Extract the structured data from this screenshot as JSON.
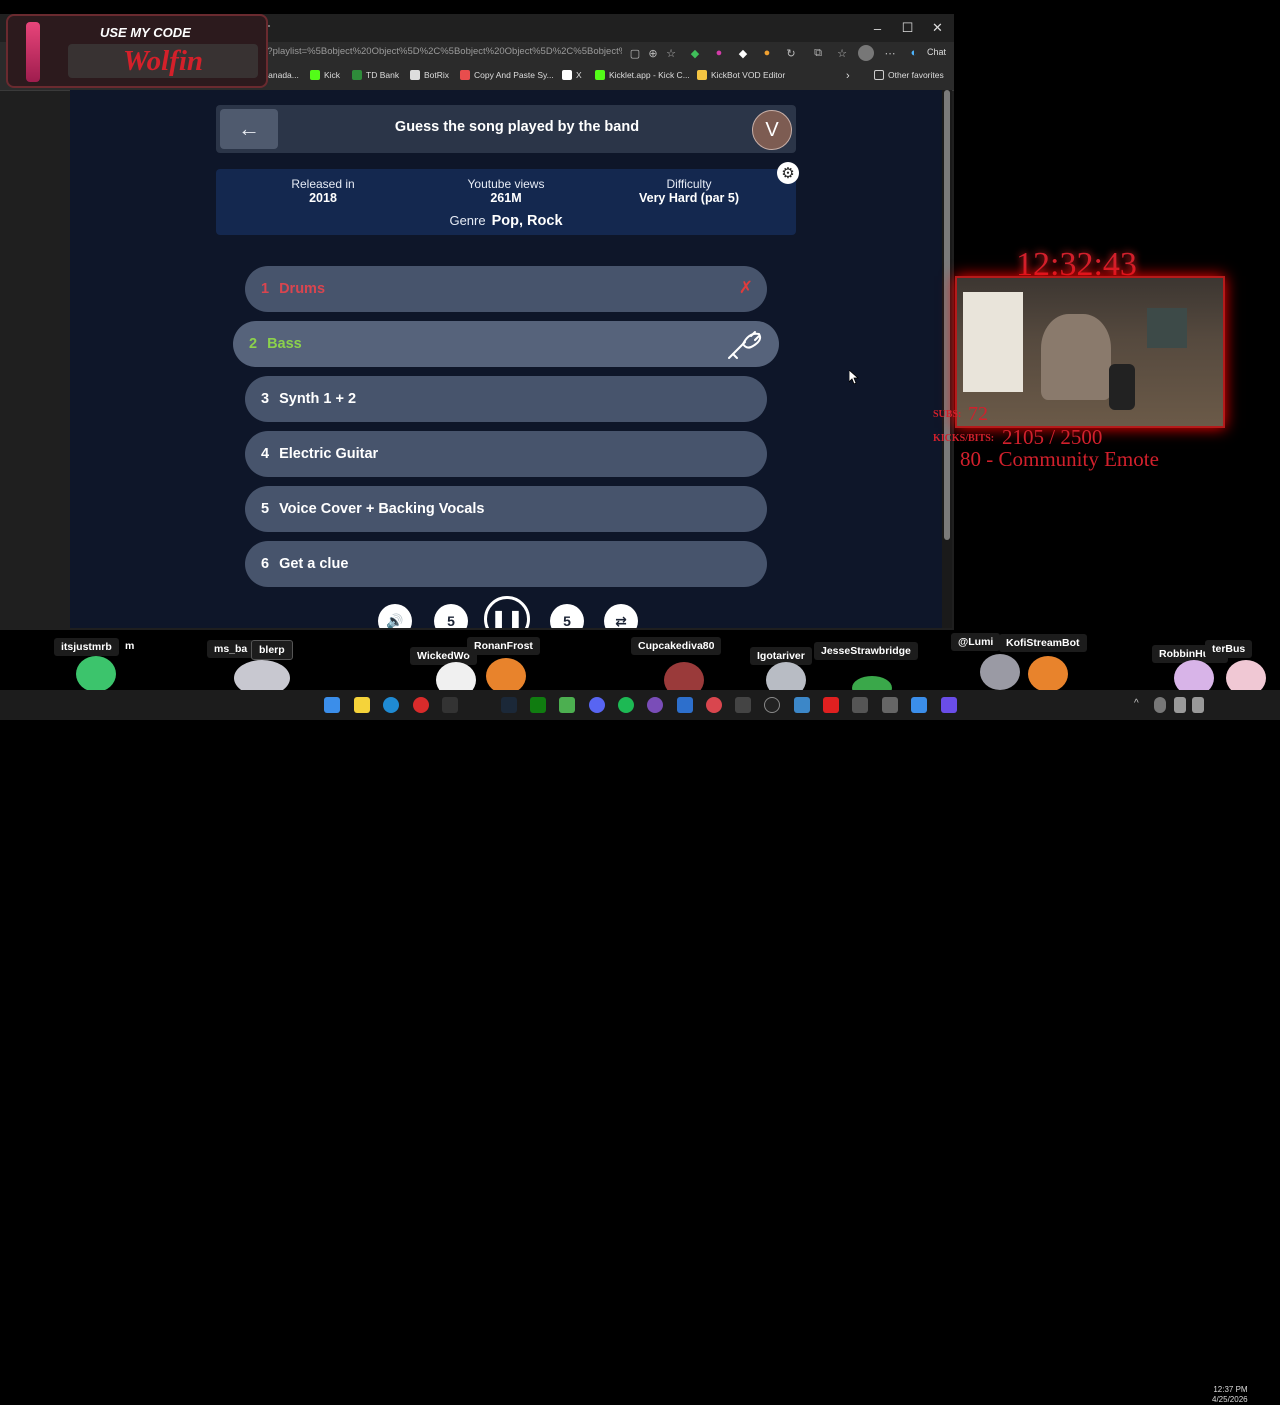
{
  "browser": {
    "url": "e?playlist=%5Bobject%20Object%5D%2C%5Bobject%20Object%5D%2C%5Bobject%20Object%5D%2C%5Bobject%",
    "chat_label": "Chat",
    "window_controls": {
      "minimize": "–",
      "maximize": "☐",
      "close": "✕"
    },
    "new_tab": "+",
    "bookmarks": [
      {
        "label": "Canada...",
        "icon": "bookmark-icon",
        "color": "#c0392b"
      },
      {
        "label": "Kick",
        "icon": "kick-icon",
        "color": "#53fc18"
      },
      {
        "label": "TD Bank",
        "icon": "td-bank-icon",
        "color": "#2e8b3a"
      },
      {
        "label": "BotRix",
        "icon": "botrix-icon",
        "color": "#dddddd"
      },
      {
        "label": "Copy And Paste Sy...",
        "icon": "copy-paste-icon",
        "color": "#e84d4d"
      },
      {
        "label": "X",
        "icon": "x-icon",
        "color": "#ffffff"
      },
      {
        "label": "Kicklet.app - Kick C...",
        "icon": "kicklet-icon",
        "color": "#53fc18"
      },
      {
        "label": "KickBot VOD Editor",
        "icon": "kickbot-icon",
        "color": "#f5c542"
      }
    ],
    "bookmarks_more": "›",
    "other_favorites": "Other favorites"
  },
  "game": {
    "back_label": "←",
    "title": "Guess the song played by the band",
    "avatar_initial": "V",
    "info": {
      "released_label": "Released in",
      "released_value": "2018",
      "views_label": "Youtube views",
      "views_value": "261M",
      "difficulty_label": "Difficulty",
      "difficulty_value": "Very Hard (par 5)",
      "genre_label": "Genre",
      "genre_value": "Pop, Rock"
    },
    "stems": [
      {
        "num": "1",
        "label": "Drums",
        "status": "wrong"
      },
      {
        "num": "2",
        "label": "Bass",
        "status": "active"
      },
      {
        "num": "3",
        "label": "Synth 1 + 2",
        "status": "locked"
      },
      {
        "num": "4",
        "label": "Electric Guitar",
        "status": "locked"
      },
      {
        "num": "5",
        "label": "Voice Cover + Backing Vocals",
        "status": "locked"
      },
      {
        "num": "6",
        "label": "Get a clue",
        "status": "locked"
      }
    ],
    "wrong_mark": "✗",
    "controls": {
      "rewind_label": "5",
      "forward_label": "5"
    }
  },
  "overlay": {
    "promo_label": "USE MY CODE",
    "promo_code": "Wolfin",
    "clock": "12:32:43",
    "subs_label": "SUBS:",
    "subs_value": "72",
    "kicks_label": "KICKS/BITS:",
    "kicks_value": "2105 / 2500",
    "goal": "80 - Community Emote"
  },
  "chat_users": [
    "itsjustmrb",
    "m",
    "ms_ba",
    "blerp",
    "WickedWo",
    "RonanFrost",
    "Cupcakediva80",
    "Igotariver",
    "JesseStrawbridge",
    "@Lumi",
    "KofiStreamBot",
    "RobbinHudz",
    "terBus"
  ],
  "taskbar": {
    "time": "12:37 PM",
    "date": "4/25/2026"
  }
}
